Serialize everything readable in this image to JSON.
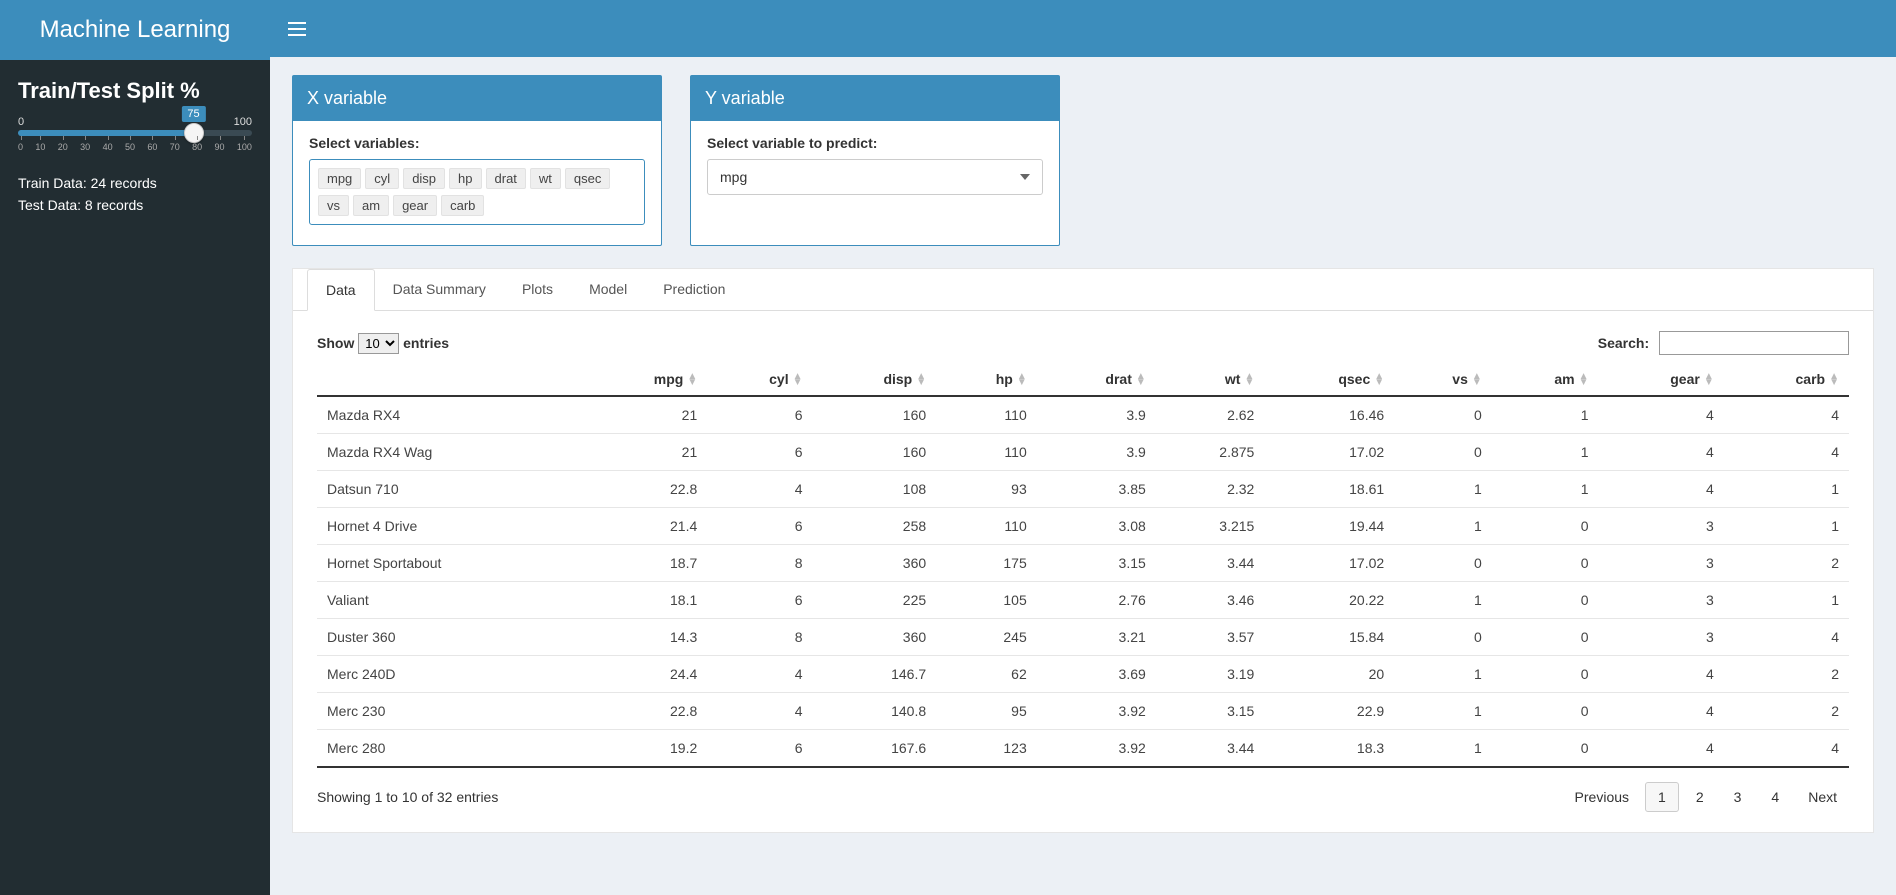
{
  "brand": "Machine Learning",
  "sidebar": {
    "title": "Train/Test Split %",
    "slider": {
      "min": "0",
      "max": "100",
      "value": "75",
      "scale": [
        "0",
        "10",
        "20",
        "30",
        "40",
        "50",
        "60",
        "70",
        "80",
        "90",
        "100"
      ]
    },
    "train_line": "Train Data: 24 records",
    "test_line": "Test Data: 8 records"
  },
  "xbox": {
    "title": "X variable",
    "label": "Select variables:",
    "chips": [
      "mpg",
      "cyl",
      "disp",
      "hp",
      "drat",
      "wt",
      "qsec",
      "vs",
      "am",
      "gear",
      "carb"
    ]
  },
  "ybox": {
    "title": "Y variable",
    "label": "Select variable to predict:",
    "selected": "mpg"
  },
  "tabs": [
    "Data",
    "Data Summary",
    "Plots",
    "Model",
    "Prediction"
  ],
  "active_tab": 0,
  "dt": {
    "show_prefix": "Show",
    "show_suffix": "entries",
    "length_options": [
      "10"
    ],
    "length_value": "10",
    "search_label": "Search:",
    "search_value": "",
    "columns": [
      "",
      "mpg",
      "cyl",
      "disp",
      "hp",
      "drat",
      "wt",
      "qsec",
      "vs",
      "am",
      "gear",
      "carb"
    ],
    "rows": [
      [
        "Mazda RX4",
        "21",
        "6",
        "160",
        "110",
        "3.9",
        "2.62",
        "16.46",
        "0",
        "1",
        "4",
        "4"
      ],
      [
        "Mazda RX4 Wag",
        "21",
        "6",
        "160",
        "110",
        "3.9",
        "2.875",
        "17.02",
        "0",
        "1",
        "4",
        "4"
      ],
      [
        "Datsun 710",
        "22.8",
        "4",
        "108",
        "93",
        "3.85",
        "2.32",
        "18.61",
        "1",
        "1",
        "4",
        "1"
      ],
      [
        "Hornet 4 Drive",
        "21.4",
        "6",
        "258",
        "110",
        "3.08",
        "3.215",
        "19.44",
        "1",
        "0",
        "3",
        "1"
      ],
      [
        "Hornet Sportabout",
        "18.7",
        "8",
        "360",
        "175",
        "3.15",
        "3.44",
        "17.02",
        "0",
        "0",
        "3",
        "2"
      ],
      [
        "Valiant",
        "18.1",
        "6",
        "225",
        "105",
        "2.76",
        "3.46",
        "20.22",
        "1",
        "0",
        "3",
        "1"
      ],
      [
        "Duster 360",
        "14.3",
        "8",
        "360",
        "245",
        "3.21",
        "3.57",
        "15.84",
        "0",
        "0",
        "3",
        "4"
      ],
      [
        "Merc 240D",
        "24.4",
        "4",
        "146.7",
        "62",
        "3.69",
        "3.19",
        "20",
        "1",
        "0",
        "4",
        "2"
      ],
      [
        "Merc 230",
        "22.8",
        "4",
        "140.8",
        "95",
        "3.92",
        "3.15",
        "22.9",
        "1",
        "0",
        "4",
        "2"
      ],
      [
        "Merc 280",
        "19.2",
        "6",
        "167.6",
        "123",
        "3.92",
        "3.44",
        "18.3",
        "1",
        "0",
        "4",
        "4"
      ]
    ],
    "info": "Showing 1 to 10 of 32 entries",
    "prev": "Previous",
    "next": "Next",
    "pages": [
      "1",
      "2",
      "3",
      "4"
    ],
    "active_page": 0
  }
}
